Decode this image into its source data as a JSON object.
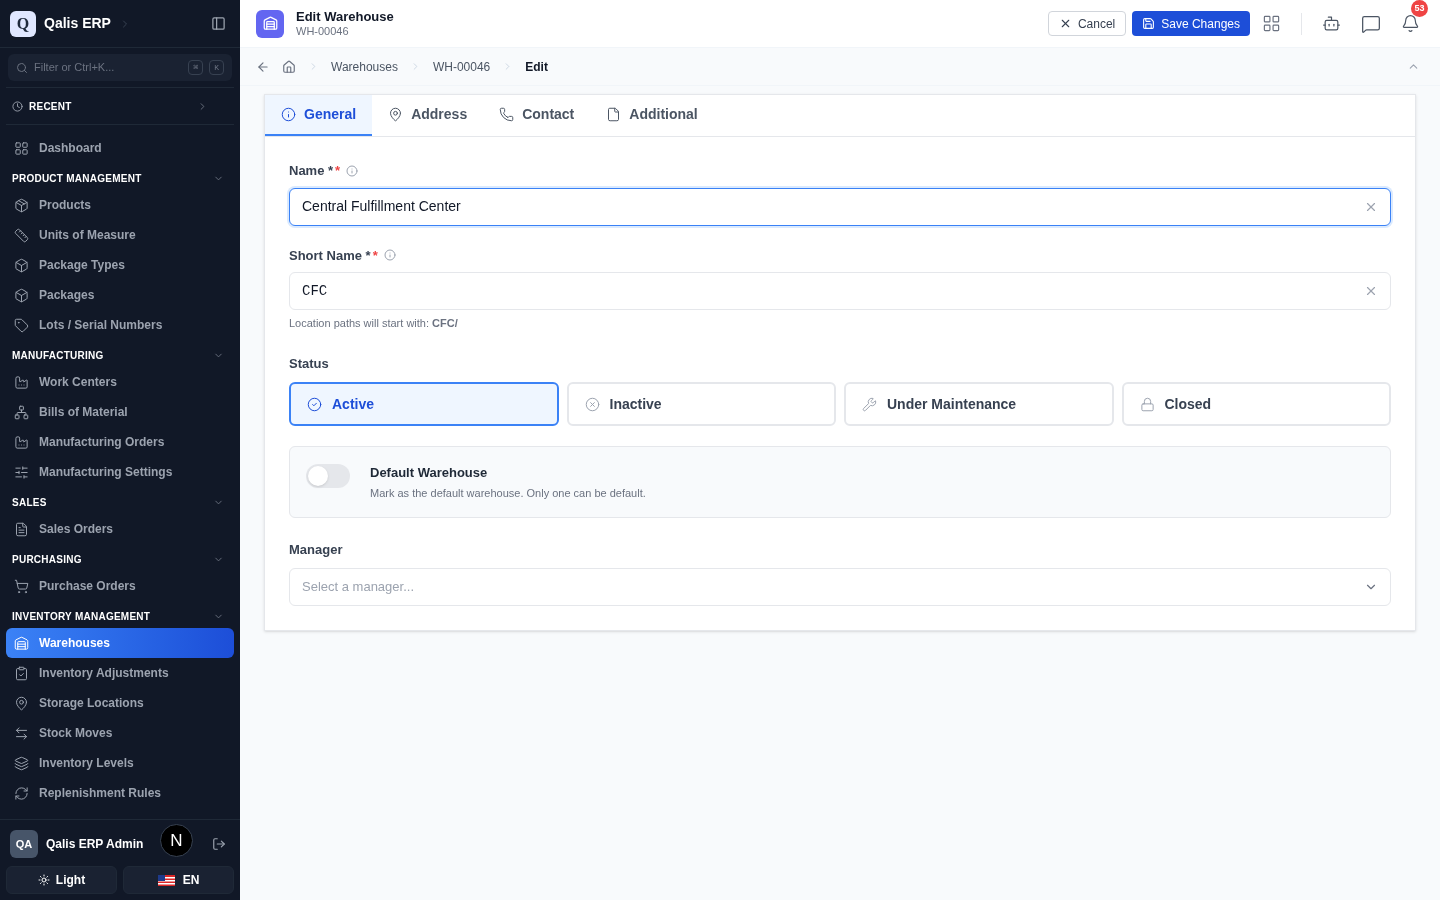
{
  "app": {
    "name": "Qalis ERP",
    "logo": "Q"
  },
  "sidebar": {
    "filter": {
      "placeholder": "Filter or Ctrl+K...",
      "keys": [
        "⌘",
        "K"
      ]
    },
    "recent": "RECENT",
    "nav": [
      {
        "kind": "item",
        "label": "Dashboard",
        "selected": false
      },
      {
        "kind": "section",
        "label": "PRODUCT MANAGEMENT",
        "expanded": true,
        "children": [
          {
            "label": "Products",
            "selected": false
          },
          {
            "label": "Units of Measure",
            "selected": false
          },
          {
            "label": "Package Types",
            "selected": false
          },
          {
            "label": "Packages",
            "selected": false
          },
          {
            "label": "Lots / Serial Numbers",
            "selected": false
          }
        ]
      },
      {
        "kind": "section",
        "label": "MANUFACTURING",
        "expanded": true,
        "children": [
          {
            "label": "Work Centers",
            "selected": false
          },
          {
            "label": "Bills of Material",
            "selected": false
          },
          {
            "label": "Manufacturing Orders",
            "selected": false
          },
          {
            "label": "Manufacturing Settings",
            "selected": false
          }
        ]
      },
      {
        "kind": "section",
        "label": "SALES",
        "expanded": true,
        "children": [
          {
            "label": "Sales Orders",
            "selected": false
          }
        ]
      },
      {
        "kind": "section",
        "label": "PURCHASING",
        "expanded": true,
        "children": [
          {
            "label": "Purchase Orders",
            "selected": false
          }
        ]
      },
      {
        "kind": "section",
        "label": "INVENTORY MANAGEMENT",
        "expanded": true,
        "children": [
          {
            "label": "Warehouses",
            "selected": true
          },
          {
            "label": "Inventory Adjustments",
            "selected": false
          },
          {
            "label": "Storage Locations",
            "selected": false
          },
          {
            "label": "Stock Moves",
            "selected": false
          },
          {
            "label": "Inventory Levels",
            "selected": false
          },
          {
            "label": "Replenishment Rules",
            "selected": false
          }
        ]
      }
    ],
    "user": {
      "initials": "QA",
      "name": "Qalis ERP Admin"
    },
    "theme_button": "Light",
    "language_button": "EN",
    "dev_badge": "N"
  },
  "header": {
    "title": "Edit Warehouse",
    "subtitle": "WH-00046",
    "cancel": "Cancel",
    "save": "Save Changes",
    "notifications": "53"
  },
  "breadcrumbs": [
    "Warehouses",
    "WH-00046",
    "Edit"
  ],
  "tabs": [
    {
      "label": "General",
      "selected": true
    },
    {
      "label": "Address",
      "selected": false
    },
    {
      "label": "Contact",
      "selected": false
    },
    {
      "label": "Additional",
      "selected": false
    }
  ],
  "form": {
    "name": {
      "label": "Name *",
      "required_mark": "*",
      "value": "Central Fulfillment Center"
    },
    "short_name": {
      "label": "Short Name *",
      "required_mark": "*",
      "value": "CFC",
      "hint": "Location paths will start with: **CFC/**"
    },
    "status": {
      "label": "Status",
      "options": [
        {
          "label": "Active",
          "selected": true
        },
        {
          "label": "Inactive",
          "selected": false
        },
        {
          "label": "Under Maintenance",
          "selected": false
        },
        {
          "label": "Closed",
          "selected": false
        }
      ]
    },
    "default_warehouse": {
      "title": "Default Warehouse",
      "description": "Mark as the default warehouse. Only one can be default.",
      "on": false
    },
    "manager": {
      "label": "Manager",
      "placeholder": "Select a manager..."
    }
  }
}
